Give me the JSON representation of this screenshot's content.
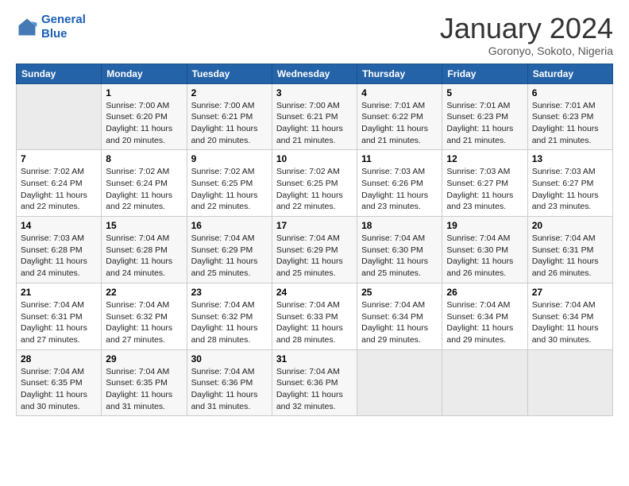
{
  "logo": {
    "line1": "General",
    "line2": "Blue"
  },
  "title": "January 2024",
  "location": "Goronyo, Sokoto, Nigeria",
  "days_of_week": [
    "Sunday",
    "Monday",
    "Tuesday",
    "Wednesday",
    "Thursday",
    "Friday",
    "Saturday"
  ],
  "weeks": [
    [
      {
        "num": "",
        "sunrise": "",
        "sunset": "",
        "daylight": ""
      },
      {
        "num": "1",
        "sunrise": "Sunrise: 7:00 AM",
        "sunset": "Sunset: 6:20 PM",
        "daylight": "Daylight: 11 hours and 20 minutes."
      },
      {
        "num": "2",
        "sunrise": "Sunrise: 7:00 AM",
        "sunset": "Sunset: 6:21 PM",
        "daylight": "Daylight: 11 hours and 20 minutes."
      },
      {
        "num": "3",
        "sunrise": "Sunrise: 7:00 AM",
        "sunset": "Sunset: 6:21 PM",
        "daylight": "Daylight: 11 hours and 21 minutes."
      },
      {
        "num": "4",
        "sunrise": "Sunrise: 7:01 AM",
        "sunset": "Sunset: 6:22 PM",
        "daylight": "Daylight: 11 hours and 21 minutes."
      },
      {
        "num": "5",
        "sunrise": "Sunrise: 7:01 AM",
        "sunset": "Sunset: 6:23 PM",
        "daylight": "Daylight: 11 hours and 21 minutes."
      },
      {
        "num": "6",
        "sunrise": "Sunrise: 7:01 AM",
        "sunset": "Sunset: 6:23 PM",
        "daylight": "Daylight: 11 hours and 21 minutes."
      }
    ],
    [
      {
        "num": "7",
        "sunrise": "Sunrise: 7:02 AM",
        "sunset": "Sunset: 6:24 PM",
        "daylight": "Daylight: 11 hours and 22 minutes."
      },
      {
        "num": "8",
        "sunrise": "Sunrise: 7:02 AM",
        "sunset": "Sunset: 6:24 PM",
        "daylight": "Daylight: 11 hours and 22 minutes."
      },
      {
        "num": "9",
        "sunrise": "Sunrise: 7:02 AM",
        "sunset": "Sunset: 6:25 PM",
        "daylight": "Daylight: 11 hours and 22 minutes."
      },
      {
        "num": "10",
        "sunrise": "Sunrise: 7:02 AM",
        "sunset": "Sunset: 6:25 PM",
        "daylight": "Daylight: 11 hours and 22 minutes."
      },
      {
        "num": "11",
        "sunrise": "Sunrise: 7:03 AM",
        "sunset": "Sunset: 6:26 PM",
        "daylight": "Daylight: 11 hours and 23 minutes."
      },
      {
        "num": "12",
        "sunrise": "Sunrise: 7:03 AM",
        "sunset": "Sunset: 6:27 PM",
        "daylight": "Daylight: 11 hours and 23 minutes."
      },
      {
        "num": "13",
        "sunrise": "Sunrise: 7:03 AM",
        "sunset": "Sunset: 6:27 PM",
        "daylight": "Daylight: 11 hours and 23 minutes."
      }
    ],
    [
      {
        "num": "14",
        "sunrise": "Sunrise: 7:03 AM",
        "sunset": "Sunset: 6:28 PM",
        "daylight": "Daylight: 11 hours and 24 minutes."
      },
      {
        "num": "15",
        "sunrise": "Sunrise: 7:04 AM",
        "sunset": "Sunset: 6:28 PM",
        "daylight": "Daylight: 11 hours and 24 minutes."
      },
      {
        "num": "16",
        "sunrise": "Sunrise: 7:04 AM",
        "sunset": "Sunset: 6:29 PM",
        "daylight": "Daylight: 11 hours and 25 minutes."
      },
      {
        "num": "17",
        "sunrise": "Sunrise: 7:04 AM",
        "sunset": "Sunset: 6:29 PM",
        "daylight": "Daylight: 11 hours and 25 minutes."
      },
      {
        "num": "18",
        "sunrise": "Sunrise: 7:04 AM",
        "sunset": "Sunset: 6:30 PM",
        "daylight": "Daylight: 11 hours and 25 minutes."
      },
      {
        "num": "19",
        "sunrise": "Sunrise: 7:04 AM",
        "sunset": "Sunset: 6:30 PM",
        "daylight": "Daylight: 11 hours and 26 minutes."
      },
      {
        "num": "20",
        "sunrise": "Sunrise: 7:04 AM",
        "sunset": "Sunset: 6:31 PM",
        "daylight": "Daylight: 11 hours and 26 minutes."
      }
    ],
    [
      {
        "num": "21",
        "sunrise": "Sunrise: 7:04 AM",
        "sunset": "Sunset: 6:31 PM",
        "daylight": "Daylight: 11 hours and 27 minutes."
      },
      {
        "num": "22",
        "sunrise": "Sunrise: 7:04 AM",
        "sunset": "Sunset: 6:32 PM",
        "daylight": "Daylight: 11 hours and 27 minutes."
      },
      {
        "num": "23",
        "sunrise": "Sunrise: 7:04 AM",
        "sunset": "Sunset: 6:32 PM",
        "daylight": "Daylight: 11 hours and 28 minutes."
      },
      {
        "num": "24",
        "sunrise": "Sunrise: 7:04 AM",
        "sunset": "Sunset: 6:33 PM",
        "daylight": "Daylight: 11 hours and 28 minutes."
      },
      {
        "num": "25",
        "sunrise": "Sunrise: 7:04 AM",
        "sunset": "Sunset: 6:34 PM",
        "daylight": "Daylight: 11 hours and 29 minutes."
      },
      {
        "num": "26",
        "sunrise": "Sunrise: 7:04 AM",
        "sunset": "Sunset: 6:34 PM",
        "daylight": "Daylight: 11 hours and 29 minutes."
      },
      {
        "num": "27",
        "sunrise": "Sunrise: 7:04 AM",
        "sunset": "Sunset: 6:34 PM",
        "daylight": "Daylight: 11 hours and 30 minutes."
      }
    ],
    [
      {
        "num": "28",
        "sunrise": "Sunrise: 7:04 AM",
        "sunset": "Sunset: 6:35 PM",
        "daylight": "Daylight: 11 hours and 30 minutes."
      },
      {
        "num": "29",
        "sunrise": "Sunrise: 7:04 AM",
        "sunset": "Sunset: 6:35 PM",
        "daylight": "Daylight: 11 hours and 31 minutes."
      },
      {
        "num": "30",
        "sunrise": "Sunrise: 7:04 AM",
        "sunset": "Sunset: 6:36 PM",
        "daylight": "Daylight: 11 hours and 31 minutes."
      },
      {
        "num": "31",
        "sunrise": "Sunrise: 7:04 AM",
        "sunset": "Sunset: 6:36 PM",
        "daylight": "Daylight: 11 hours and 32 minutes."
      },
      {
        "num": "",
        "sunrise": "",
        "sunset": "",
        "daylight": ""
      },
      {
        "num": "",
        "sunrise": "",
        "sunset": "",
        "daylight": ""
      },
      {
        "num": "",
        "sunrise": "",
        "sunset": "",
        "daylight": ""
      }
    ]
  ]
}
